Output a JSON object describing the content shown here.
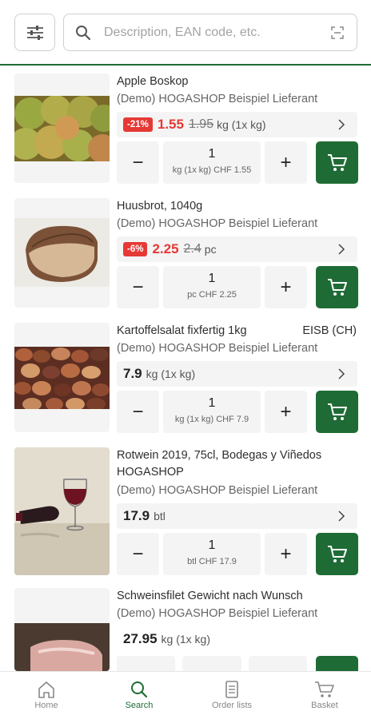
{
  "search": {
    "placeholder": "Description, EAN code, etc."
  },
  "colors": {
    "brand": "#1f6b35",
    "discount": "#e53935"
  },
  "products": [
    {
      "name": "Apple Boskop",
      "supplier": "(Demo) HOGASHOP Beispiel Lieferant",
      "discount": "-21%",
      "price": "1.55",
      "old_price": "1.95",
      "unit": "kg (1x kg)",
      "qty": "1",
      "qty_label": "kg (1x kg) CHF 1.55",
      "origin": ""
    },
    {
      "name": "Huusbrot, 1040g",
      "supplier": "(Demo) HOGASHOP Beispiel Lieferant",
      "discount": "-6%",
      "price": "2.25",
      "old_price": "2.4",
      "unit": "pc",
      "qty": "1",
      "qty_label": "pc CHF 2.25",
      "origin": ""
    },
    {
      "name": "Kartoffelsalat fixfertig 1kg",
      "supplier": "(Demo) HOGASHOP Beispiel Lieferant",
      "discount": "",
      "price": "7.9",
      "old_price": "",
      "unit": "kg (1x kg)",
      "qty": "1",
      "qty_label": "kg (1x kg) CHF 7.9",
      "origin": "EISB (CH)"
    },
    {
      "name": "Rotwein 2019, 75cl, Bodegas y Viñedos HOGASHOP",
      "supplier": "(Demo) HOGASHOP Beispiel Lieferant",
      "discount": "",
      "price": "17.9",
      "old_price": "",
      "unit": "btl",
      "qty": "1",
      "qty_label": "btl CHF 17.9",
      "origin": ""
    },
    {
      "name": "Schweinsfilet Gewicht nach Wunsch",
      "supplier": "(Demo) HOGASHOP Beispiel Lieferant",
      "discount": "",
      "price": "27.95",
      "old_price": "",
      "unit": "kg (1x kg)",
      "qty": "",
      "qty_label": "",
      "origin": ""
    }
  ],
  "icons": {
    "filter": "sliders-icon",
    "search": "search-icon",
    "scan": "barcode-scan-icon",
    "chevron": "chevron-right-icon",
    "cart": "cart-icon"
  },
  "nav": [
    {
      "label": "Home",
      "icon": "home-icon",
      "active": false
    },
    {
      "label": "Search",
      "icon": "search-icon",
      "active": true
    },
    {
      "label": "Order lists",
      "icon": "document-icon",
      "active": false
    },
    {
      "label": "Basket",
      "icon": "basket-icon",
      "active": false
    }
  ]
}
